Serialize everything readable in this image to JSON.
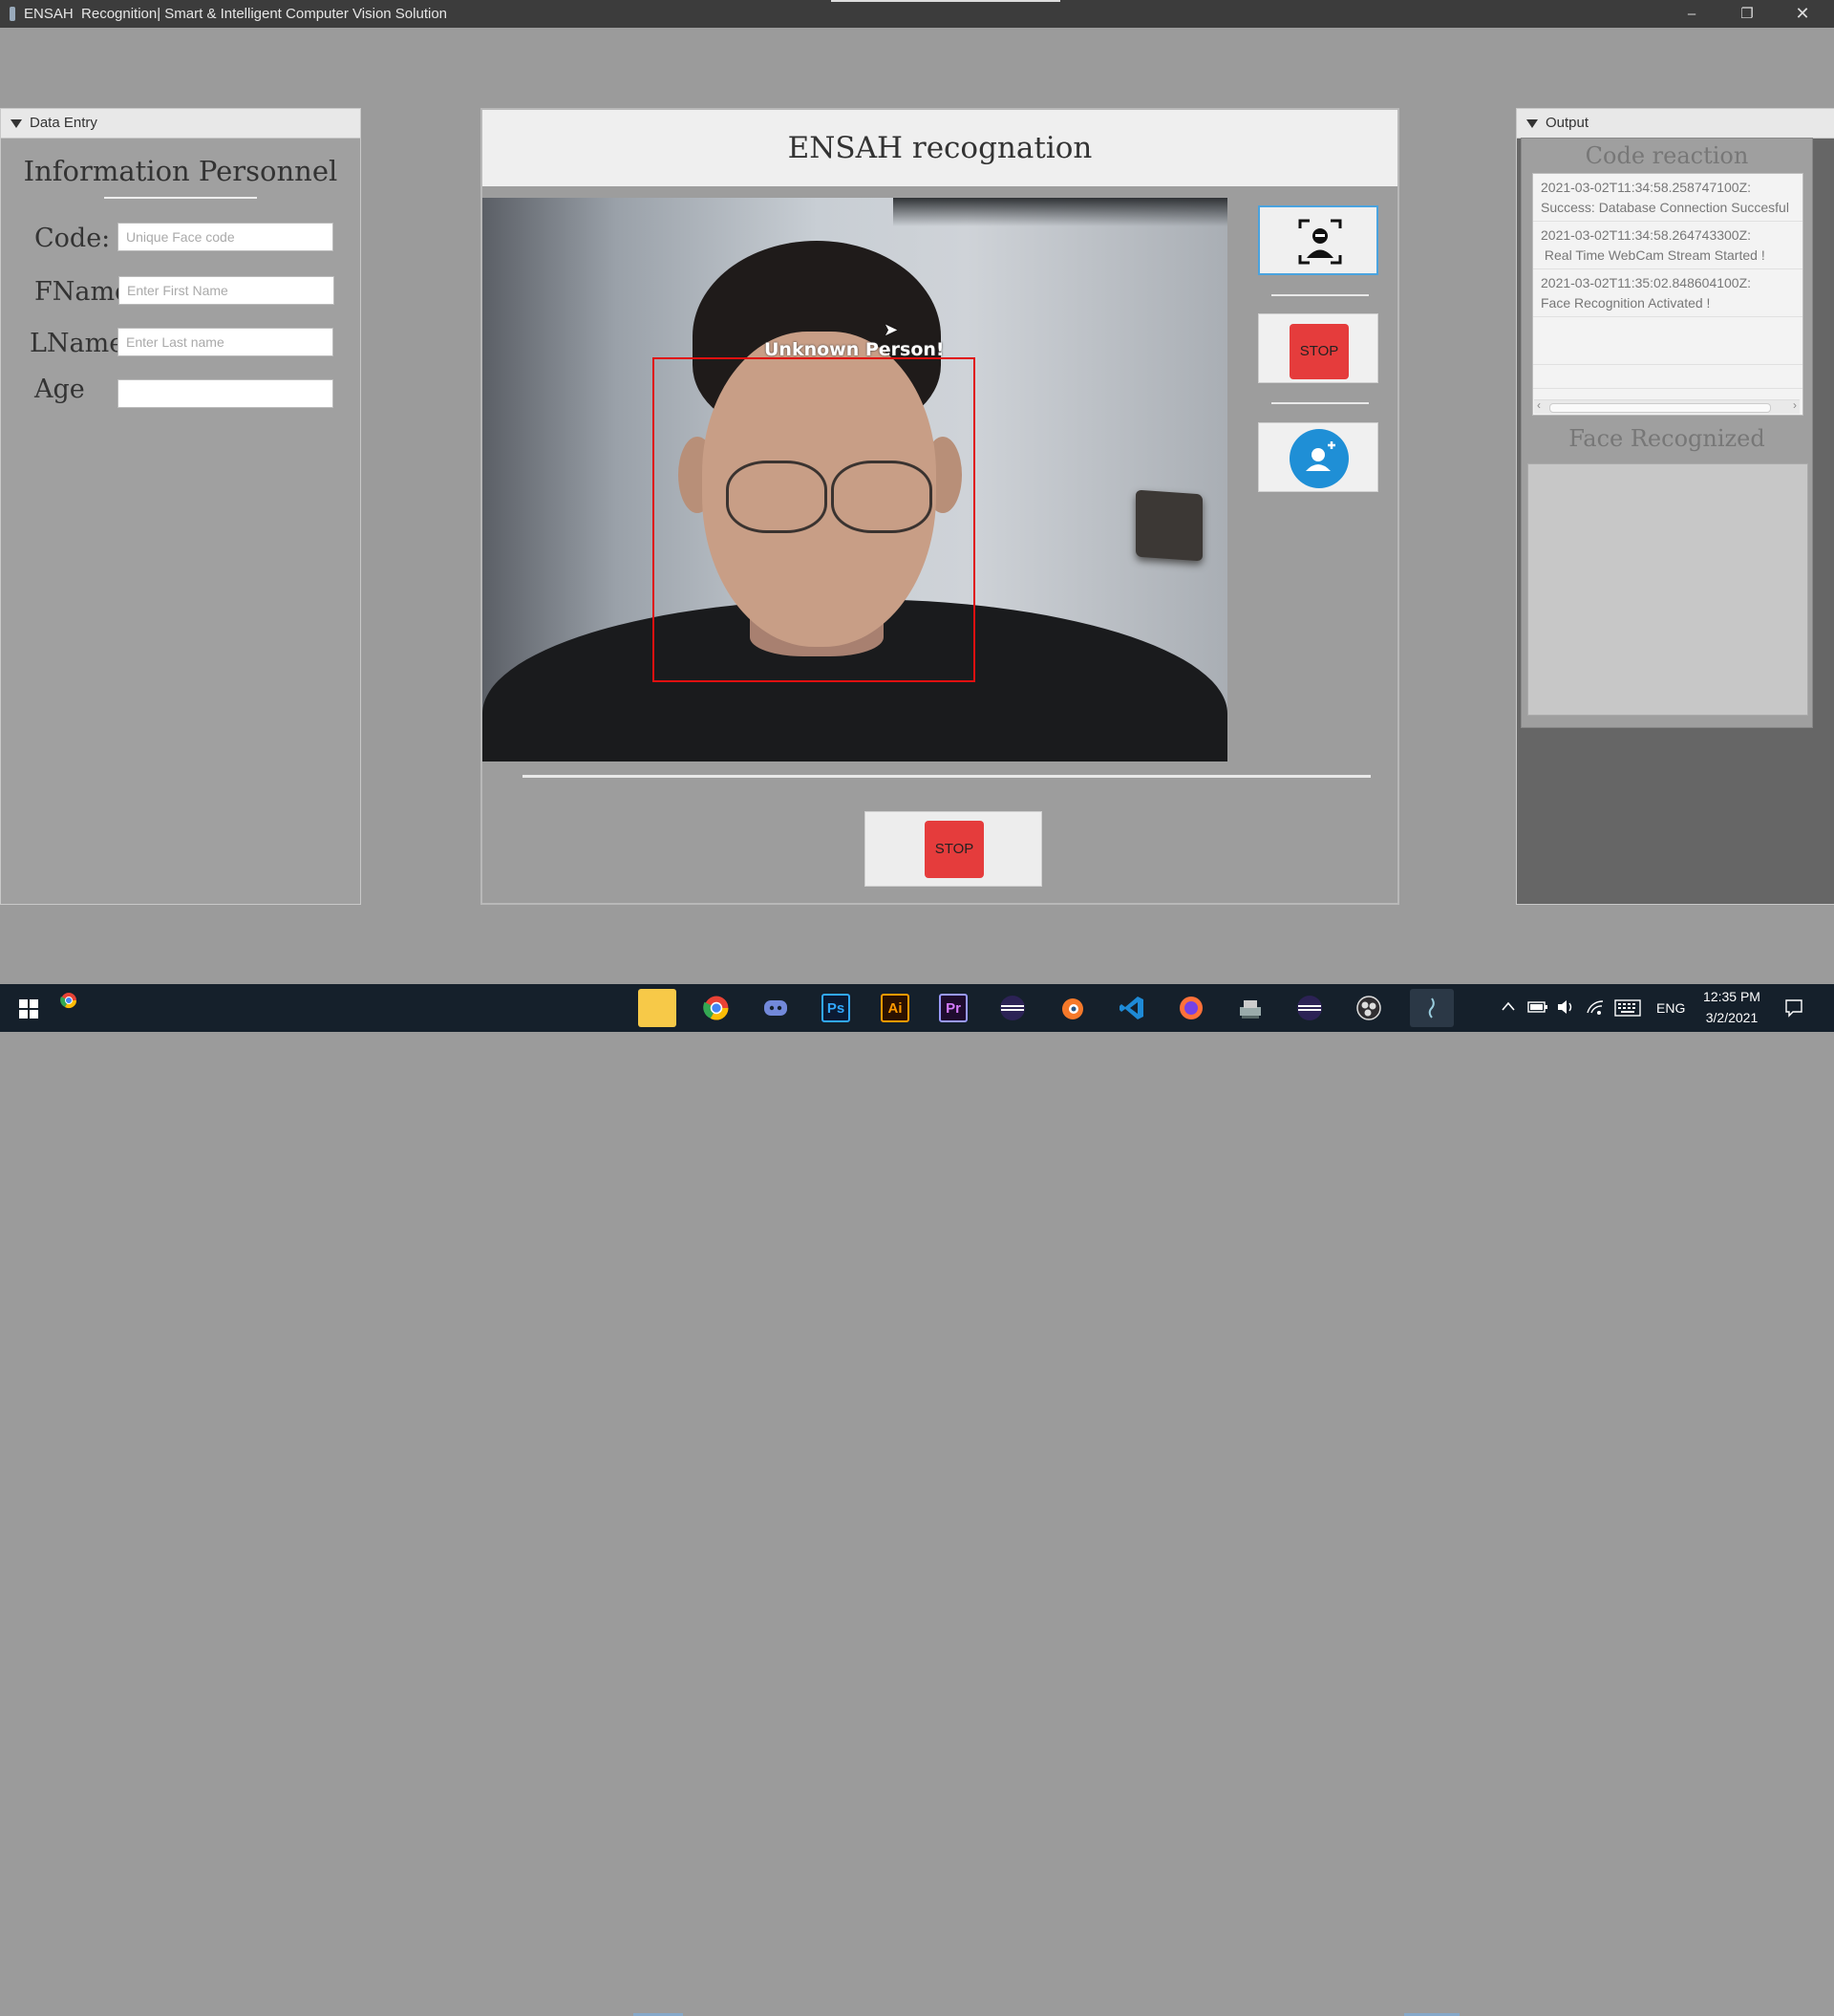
{
  "window": {
    "title": "ENSAH  Recognition| Smart & Intelligent Computer Vision Solution",
    "min": "–",
    "max": "❐",
    "close": "✕"
  },
  "data_entry": {
    "header": "Data Entry",
    "title": "Information Personnel",
    "fields": [
      {
        "label": "Code:",
        "placeholder": "Unique Face code",
        "value": ""
      },
      {
        "label": "FName",
        "placeholder": "Enter First Name",
        "value": ""
      },
      {
        "label": "LName",
        "placeholder": "Enter Last name",
        "value": ""
      },
      {
        "label": "Age",
        "placeholder": "",
        "value": ""
      }
    ]
  },
  "main": {
    "title": "ENSAH recognation",
    "detection_label": "Unknown Person!",
    "stop_label_side": "STOP",
    "stop_label_bottom": "STOP"
  },
  "output": {
    "header": "Output",
    "code_reaction_title": "Code reaction",
    "face_recognized_title": "Face Recognized",
    "logs": [
      {
        "time": "2021-03-02T11:34:58.258747100Z:",
        "message": "Success: Database Connection Succesful"
      },
      {
        "time": "2021-03-02T11:34:58.264743300Z:",
        "message": " Real Time WebCam Stream Started !"
      },
      {
        "time": "2021-03-02T11:35:02.848604100Z:",
        "message": "Face Recognition Activated !"
      }
    ]
  },
  "taskbar": {
    "apps": [
      "file-explorer",
      "chrome",
      "discord",
      "photoshop",
      "illustrator",
      "premiere-pro",
      "eclipse",
      "blender",
      "vscode",
      "firefox",
      "app-utility",
      "eclipse-2",
      "obs",
      "java"
    ],
    "ps_label": "Ps",
    "ai_label": "Ai",
    "pr_label": "Pr",
    "lang": "ENG",
    "time": "12:35 PM",
    "date": "3/2/2021",
    "colors": {
      "taskbar": "#15202b",
      "accent": "#4aa3df",
      "stop": "#e53c3c"
    }
  }
}
